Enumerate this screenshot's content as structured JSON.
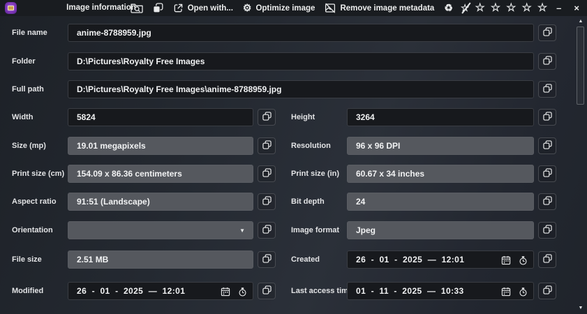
{
  "window": {
    "title": "Image information"
  },
  "toolbar": {
    "open_with": "Open with...",
    "optimize": "Optimize image",
    "remove_metadata": "Remove image metadata"
  },
  "icons": {
    "star": "☆",
    "recycle": "♻",
    "gear": "⚙",
    "minimize": "–",
    "close": "×",
    "chevron_down": "▼",
    "scroll_up": "▲",
    "scroll_down": "▼"
  },
  "colors": {
    "accent_purple": "#7a35b5",
    "field_dark": "#17191d",
    "field_gray": "#55585e",
    "titlebar": "#191c20"
  },
  "form": {
    "file_name": {
      "label": "File name",
      "value": "anime-8788959.jpg"
    },
    "folder": {
      "label": "Folder",
      "value": "D:\\Pictures\\Royalty Free Images"
    },
    "full_path": {
      "label": "Full path",
      "value": "D:\\Pictures\\Royalty Free Images\\anime-8788959.jpg"
    },
    "width": {
      "label": "Width",
      "value": "5824"
    },
    "height": {
      "label": "Height",
      "value": "3264"
    },
    "size_mp": {
      "label": "Size (mp)",
      "value": "19.01 megapixels"
    },
    "resolution": {
      "label": "Resolution",
      "value": "96 x 96 DPI"
    },
    "print_cm": {
      "label": "Print size (cm)",
      "value": "154.09 x 86.36 centimeters"
    },
    "print_in": {
      "label": "Print size (in)",
      "value": "60.67 x 34 inches"
    },
    "aspect_ratio": {
      "label": "Aspect ratio",
      "value": "91:51 (Landscape)"
    },
    "bit_depth": {
      "label": "Bit depth",
      "value": "24"
    },
    "orientation": {
      "label": "Orientation",
      "value": ""
    },
    "image_format": {
      "label": "Image format",
      "value": "Jpeg"
    },
    "file_size": {
      "label": "File size",
      "value": "2.51 MB"
    },
    "created": {
      "label": "Created",
      "value": "26  -  01  -  2025  —  12:01"
    },
    "modified": {
      "label": "Modified",
      "value": "26  -  01  -  2025  —  12:01"
    },
    "last_access": {
      "label": "Last access time",
      "value": "01  -  11  -  2025  —  10:33"
    }
  }
}
